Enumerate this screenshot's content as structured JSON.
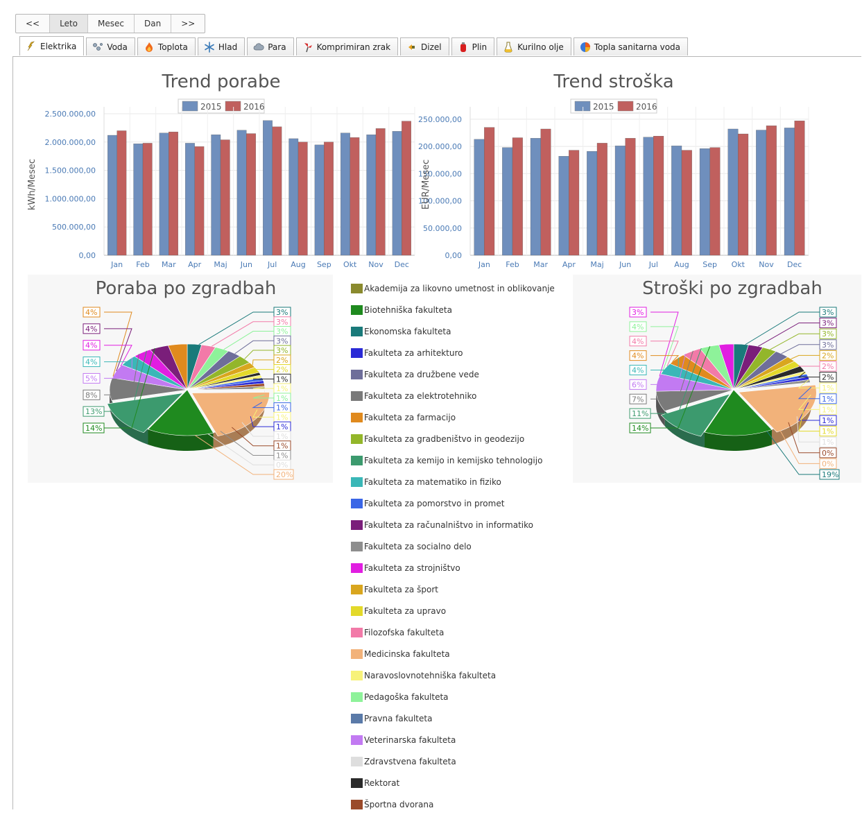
{
  "period_nav": {
    "buttons": [
      {
        "label": "<<",
        "active": false
      },
      {
        "label": "Leto",
        "active": true
      },
      {
        "label": "Mesec",
        "active": false
      },
      {
        "label": "Dan",
        "active": false
      },
      {
        "label": ">>",
        "active": false
      }
    ]
  },
  "tabs": [
    {
      "label": "Elektrika",
      "icon": "lightning-icon",
      "active": true
    },
    {
      "label": "Voda",
      "icon": "water-drops-icon",
      "active": false
    },
    {
      "label": "Toplota",
      "icon": "flame-icon",
      "active": false
    },
    {
      "label": "Hlad",
      "icon": "snowflake-icon",
      "active": false
    },
    {
      "label": "Para",
      "icon": "cloud-icon",
      "active": false
    },
    {
      "label": "Komprimiran zrak",
      "icon": "fan-icon",
      "active": false
    },
    {
      "label": "Dizel",
      "icon": "diesel-icon",
      "active": false
    },
    {
      "label": "Plin",
      "icon": "gas-canister-icon",
      "active": false
    },
    {
      "label": "Kurilno olje",
      "icon": "oil-flask-icon",
      "active": false
    },
    {
      "label": "Topla sanitarna voda",
      "icon": "pie-icon",
      "active": false
    }
  ],
  "series_colors": {
    "2015": "#6f8fbd",
    "2016": "#c0605e"
  },
  "chart_data": [
    {
      "type": "bar",
      "title": "Trend porabe",
      "ylabel": "kWh/Mesec",
      "categories": [
        "Jan",
        "Feb",
        "Mar",
        "Apr",
        "Maj",
        "Jun",
        "Jul",
        "Aug",
        "Sep",
        "Okt",
        "Nov",
        "Dec"
      ],
      "series": [
        {
          "name": "2015",
          "values": [
            2120000,
            1970000,
            2160000,
            1980000,
            2130000,
            2210000,
            2380000,
            2060000,
            1950000,
            2160000,
            2130000,
            2190000
          ]
        },
        {
          "name": "2016",
          "values": [
            2200000,
            1980000,
            2180000,
            1920000,
            2040000,
            2150000,
            2270000,
            2000000,
            2000000,
            2080000,
            2240000,
            2370000
          ]
        }
      ],
      "ylim": [
        0,
        2500000
      ],
      "yticks": [
        "0,00",
        "500.000,00",
        "1.000.000,00",
        "1.500.000,00",
        "2.000.000,00",
        "2.500.000,00"
      ],
      "grid": true,
      "legend": "top-center"
    },
    {
      "type": "bar",
      "title": "Trend stroška",
      "ylabel": "EUR/Mesec",
      "categories": [
        "Jan",
        "Feb",
        "Mar",
        "Apr",
        "Maj",
        "Jun",
        "Jul",
        "Aug",
        "Sep",
        "Okt",
        "Nov",
        "Dec"
      ],
      "series": [
        {
          "name": "2015",
          "values": [
            213000,
            198000,
            215000,
            182000,
            191000,
            201000,
            217000,
            201000,
            196000,
            232000,
            230000,
            234000
          ]
        },
        {
          "name": "2016",
          "values": [
            235000,
            216000,
            232000,
            193000,
            206000,
            215000,
            219000,
            193000,
            198000,
            223000,
            238000,
            247000
          ]
        }
      ],
      "ylim": [
        0,
        260000
      ],
      "yticks": [
        "0,00",
        "50.000,00",
        "100.000,00",
        "150.000,00",
        "200.000,00",
        "250.000,00"
      ],
      "grid": true,
      "legend": "top-center"
    },
    {
      "type": "pie",
      "title": "Poraba po zgradbah",
      "left_labels": [
        "4%",
        "4%",
        "4%",
        "4%",
        "5%",
        "8%",
        "13%",
        "14%"
      ],
      "right_labels": [
        "3%",
        "3%",
        "3%",
        "3%",
        "3%",
        "2%",
        "2%",
        "1%",
        "1%",
        "1%",
        "1%",
        "1%",
        "1%",
        "1%",
        "1%",
        "1%",
        "0%",
        "20%"
      ]
    },
    {
      "type": "pie",
      "title": "Stroški po zgradbah",
      "left_labels": [
        "3%",
        "4%",
        "4%",
        "4%",
        "4%",
        "6%",
        "7%",
        "11%",
        "14%"
      ],
      "right_labels": [
        "3%",
        "3%",
        "3%",
        "3%",
        "2%",
        "2%",
        "2%",
        "1%",
        "1%",
        "1%",
        "1%",
        "1%",
        "1%",
        "0%",
        "0%",
        "19%"
      ]
    }
  ],
  "legend": [
    {
      "label": "Akademija za likovno umetnost in oblikovanje",
      "color": "#8a8a2e"
    },
    {
      "label": "Biotehniška fakulteta",
      "color": "#1f8a1f"
    },
    {
      "label": "Ekonomska fakulteta",
      "color": "#1a7a7a"
    },
    {
      "label": "Fakulteta za arhitekturo",
      "color": "#2a2ad6"
    },
    {
      "label": "Fakulteta za družbene vede",
      "color": "#6e6e9a"
    },
    {
      "label": "Fakulteta za elektrotehniko",
      "color": "#7a7a7a"
    },
    {
      "label": "Fakulteta za farmacijo",
      "color": "#e08a1e"
    },
    {
      "label": "Fakulteta za gradbeništvo in geodezijo",
      "color": "#93b62a"
    },
    {
      "label": "Fakulteta za kemijo in kemijsko tehnologijo",
      "color": "#3c9a6e"
    },
    {
      "label": "Fakulteta za matematiko in fiziko",
      "color": "#3ab7b7"
    },
    {
      "label": "Fakulteta za pomorstvo in promet",
      "color": "#3a66e6"
    },
    {
      "label": "Fakulteta za računalništvo in informatiko",
      "color": "#7a1e7a"
    },
    {
      "label": "Fakulteta za socialno delo",
      "color": "#8e8e8e"
    },
    {
      "label": "Fakulteta za strojništvo",
      "color": "#e11ee1"
    },
    {
      "label": "Fakulteta za šport",
      "color": "#d9a61e"
    },
    {
      "label": "Fakulteta za upravo",
      "color": "#e3d92a"
    },
    {
      "label": "Filozofska fakulteta",
      "color": "#f27aa8"
    },
    {
      "label": "Medicinska fakulteta",
      "color": "#f2b27a"
    },
    {
      "label": "Naravoslovnotehniška fakulteta",
      "color": "#f7f27a"
    },
    {
      "label": "Pedagoška fakulteta",
      "color": "#8ef29a"
    },
    {
      "label": "Pravna fakulteta",
      "color": "#5a7aa8"
    },
    {
      "label": "Veterinarska fakulteta",
      "color": "#c27af2"
    },
    {
      "label": "Zdravstvena fakulteta",
      "color": "#dedede"
    },
    {
      "label": "Rektorat",
      "color": "#2a2a2a"
    },
    {
      "label": "Športna dvorana",
      "color": "#9a4a2a"
    }
  ]
}
